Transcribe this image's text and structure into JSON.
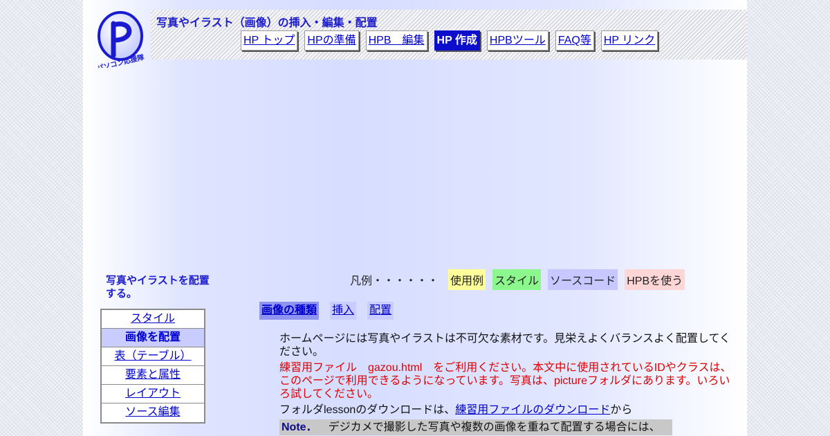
{
  "site": {
    "title": "写真やイラスト（画像）の挿入・編集・配置",
    "logo_text": "パソコン応援隊"
  },
  "nav": [
    {
      "label": "HP トップ",
      "active": false
    },
    {
      "label": "HPの準備",
      "active": false
    },
    {
      "label": "HPB　編集",
      "active": false
    },
    {
      "label": "HP 作成",
      "active": true
    },
    {
      "label": "HPBツール",
      "active": false
    },
    {
      "label": "FAQ等",
      "active": false
    },
    {
      "label": "HP リンク",
      "active": false
    }
  ],
  "sidebar": {
    "heading": "写真やイラストを配置する。",
    "items": [
      {
        "label": "スタイル",
        "active": false
      },
      {
        "label": "画像を配置",
        "active": true
      },
      {
        "label": "表（テーブル）",
        "active": false
      },
      {
        "label": "要素と属性",
        "active": false
      },
      {
        "label": "レイアウト",
        "active": false
      },
      {
        "label": "ソース編集",
        "active": false
      }
    ]
  },
  "legend": {
    "label": "凡例・・・・・・",
    "chips": [
      "使用例",
      "スタイル",
      "ソースコード",
      "HPBを使う"
    ]
  },
  "tabs": [
    {
      "label": "画像の種類",
      "active": true
    },
    {
      "label": "挿入",
      "active": false
    },
    {
      "label": "配置",
      "active": false
    }
  ],
  "content": {
    "intro": "ホームページには写真やイラストは不可欠な素材です。見栄えよくバランスよく配置してください。",
    "practice": "練習用ファイル　gazou.html　をご利用ください。本文中に使用されているIDやクラスは、このページで利用できるようになっています。写真は、pictureフォルダにあります。いろいろ試してください。",
    "download_prefix": "フォルダlessonのダウンロードは、",
    "download_link": "練習用ファイルのダウンロード",
    "download_suffix": "から",
    "note_label": "Note．",
    "note_text": "デジカメで撮影した写真や複数の画像を重ねて配置する場合には、"
  },
  "colors": {
    "accent": "#1c1ccc",
    "nav_active": "#0d0dcc",
    "practice_text": "#e00000"
  }
}
